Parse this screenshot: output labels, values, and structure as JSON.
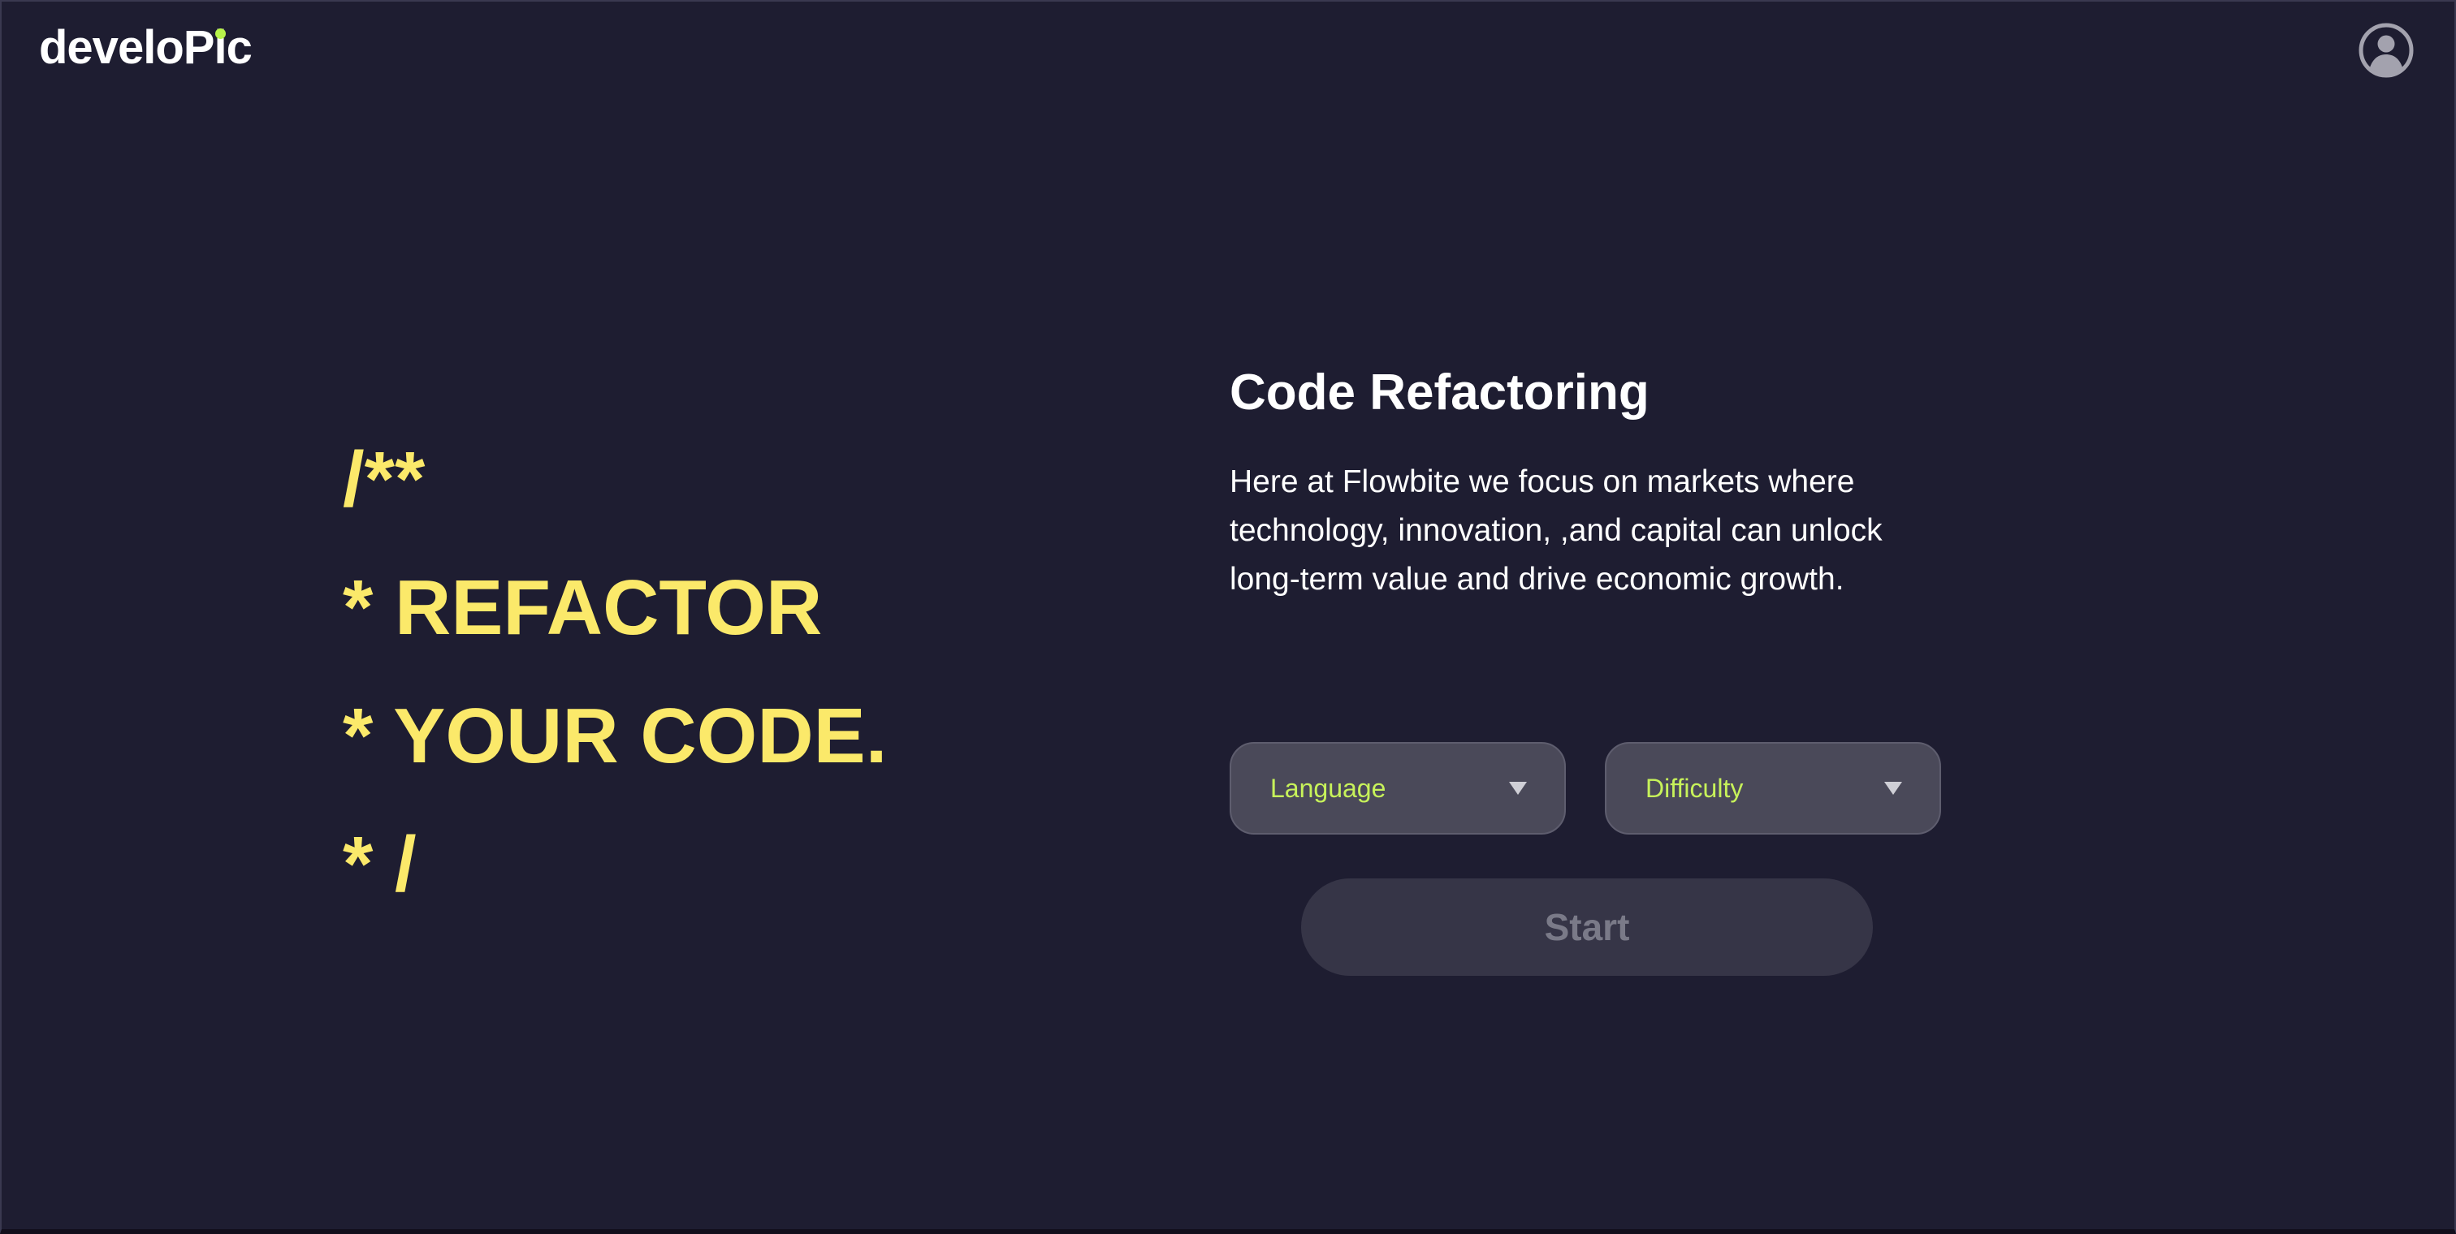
{
  "header": {
    "logo_prefix": "develoP",
    "logo_i": "i",
    "logo_suffix": "c",
    "avatar_icon": "user-circle-icon"
  },
  "hero": {
    "lines": [
      "/**",
      "* REFACTOR",
      "* YOUR CODE.",
      "* /"
    ]
  },
  "main": {
    "title": "Code Refactoring",
    "description": "Here at Flowbite we focus on markets where technology, innovation, ,and capital can unlock long-term value and drive economic growth.",
    "language_select": {
      "label": "Language"
    },
    "difficulty_select": {
      "label": "Difficulty"
    },
    "start_label": "Start"
  },
  "colors": {
    "background": "#1e1d31",
    "accent_yellow": "#fbe96a",
    "accent_green": "#c7f25a",
    "select_bg": "#4a4959",
    "button_bg": "#363547"
  }
}
